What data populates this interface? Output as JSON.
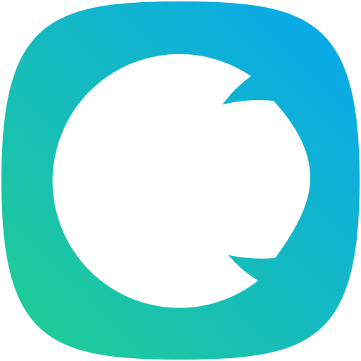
{
  "icon": {
    "name": "app-logo-icon",
    "gradient": {
      "start": "#21cf8f",
      "end": "#08a6f2"
    },
    "tile_color_note_free": "",
    "glyph_color": "#ffffff"
  }
}
